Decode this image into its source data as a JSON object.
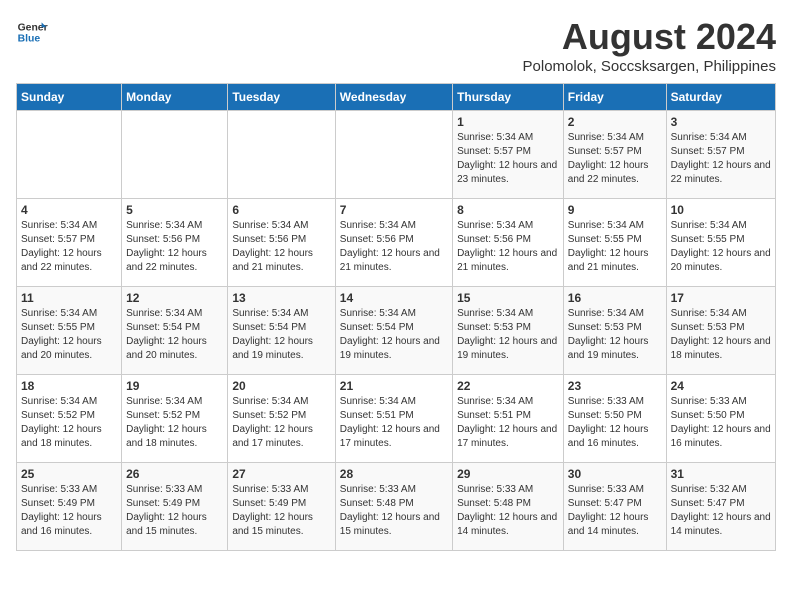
{
  "header": {
    "logo_line1": "General",
    "logo_line2": "Blue",
    "month_year": "August 2024",
    "location": "Polomolok, Soccsksargen, Philippines"
  },
  "weekdays": [
    "Sunday",
    "Monday",
    "Tuesday",
    "Wednesday",
    "Thursday",
    "Friday",
    "Saturday"
  ],
  "weeks": [
    [
      {
        "day": "",
        "sunrise": "",
        "sunset": "",
        "daylight": ""
      },
      {
        "day": "",
        "sunrise": "",
        "sunset": "",
        "daylight": ""
      },
      {
        "day": "",
        "sunrise": "",
        "sunset": "",
        "daylight": ""
      },
      {
        "day": "",
        "sunrise": "",
        "sunset": "",
        "daylight": ""
      },
      {
        "day": "1",
        "sunrise": "Sunrise: 5:34 AM",
        "sunset": "Sunset: 5:57 PM",
        "daylight": "Daylight: 12 hours and 23 minutes."
      },
      {
        "day": "2",
        "sunrise": "Sunrise: 5:34 AM",
        "sunset": "Sunset: 5:57 PM",
        "daylight": "Daylight: 12 hours and 22 minutes."
      },
      {
        "day": "3",
        "sunrise": "Sunrise: 5:34 AM",
        "sunset": "Sunset: 5:57 PM",
        "daylight": "Daylight: 12 hours and 22 minutes."
      }
    ],
    [
      {
        "day": "4",
        "sunrise": "Sunrise: 5:34 AM",
        "sunset": "Sunset: 5:57 PM",
        "daylight": "Daylight: 12 hours and 22 minutes."
      },
      {
        "day": "5",
        "sunrise": "Sunrise: 5:34 AM",
        "sunset": "Sunset: 5:56 PM",
        "daylight": "Daylight: 12 hours and 22 minutes."
      },
      {
        "day": "6",
        "sunrise": "Sunrise: 5:34 AM",
        "sunset": "Sunset: 5:56 PM",
        "daylight": "Daylight: 12 hours and 21 minutes."
      },
      {
        "day": "7",
        "sunrise": "Sunrise: 5:34 AM",
        "sunset": "Sunset: 5:56 PM",
        "daylight": "Daylight: 12 hours and 21 minutes."
      },
      {
        "day": "8",
        "sunrise": "Sunrise: 5:34 AM",
        "sunset": "Sunset: 5:56 PM",
        "daylight": "Daylight: 12 hours and 21 minutes."
      },
      {
        "day": "9",
        "sunrise": "Sunrise: 5:34 AM",
        "sunset": "Sunset: 5:55 PM",
        "daylight": "Daylight: 12 hours and 21 minutes."
      },
      {
        "day": "10",
        "sunrise": "Sunrise: 5:34 AM",
        "sunset": "Sunset: 5:55 PM",
        "daylight": "Daylight: 12 hours and 20 minutes."
      }
    ],
    [
      {
        "day": "11",
        "sunrise": "Sunrise: 5:34 AM",
        "sunset": "Sunset: 5:55 PM",
        "daylight": "Daylight: 12 hours and 20 minutes."
      },
      {
        "day": "12",
        "sunrise": "Sunrise: 5:34 AM",
        "sunset": "Sunset: 5:54 PM",
        "daylight": "Daylight: 12 hours and 20 minutes."
      },
      {
        "day": "13",
        "sunrise": "Sunrise: 5:34 AM",
        "sunset": "Sunset: 5:54 PM",
        "daylight": "Daylight: 12 hours and 19 minutes."
      },
      {
        "day": "14",
        "sunrise": "Sunrise: 5:34 AM",
        "sunset": "Sunset: 5:54 PM",
        "daylight": "Daylight: 12 hours and 19 minutes."
      },
      {
        "day": "15",
        "sunrise": "Sunrise: 5:34 AM",
        "sunset": "Sunset: 5:53 PM",
        "daylight": "Daylight: 12 hours and 19 minutes."
      },
      {
        "day": "16",
        "sunrise": "Sunrise: 5:34 AM",
        "sunset": "Sunset: 5:53 PM",
        "daylight": "Daylight: 12 hours and 19 minutes."
      },
      {
        "day": "17",
        "sunrise": "Sunrise: 5:34 AM",
        "sunset": "Sunset: 5:53 PM",
        "daylight": "Daylight: 12 hours and 18 minutes."
      }
    ],
    [
      {
        "day": "18",
        "sunrise": "Sunrise: 5:34 AM",
        "sunset": "Sunset: 5:52 PM",
        "daylight": "Daylight: 12 hours and 18 minutes."
      },
      {
        "day": "19",
        "sunrise": "Sunrise: 5:34 AM",
        "sunset": "Sunset: 5:52 PM",
        "daylight": "Daylight: 12 hours and 18 minutes."
      },
      {
        "day": "20",
        "sunrise": "Sunrise: 5:34 AM",
        "sunset": "Sunset: 5:52 PM",
        "daylight": "Daylight: 12 hours and 17 minutes."
      },
      {
        "day": "21",
        "sunrise": "Sunrise: 5:34 AM",
        "sunset": "Sunset: 5:51 PM",
        "daylight": "Daylight: 12 hours and 17 minutes."
      },
      {
        "day": "22",
        "sunrise": "Sunrise: 5:34 AM",
        "sunset": "Sunset: 5:51 PM",
        "daylight": "Daylight: 12 hours and 17 minutes."
      },
      {
        "day": "23",
        "sunrise": "Sunrise: 5:33 AM",
        "sunset": "Sunset: 5:50 PM",
        "daylight": "Daylight: 12 hours and 16 minutes."
      },
      {
        "day": "24",
        "sunrise": "Sunrise: 5:33 AM",
        "sunset": "Sunset: 5:50 PM",
        "daylight": "Daylight: 12 hours and 16 minutes."
      }
    ],
    [
      {
        "day": "25",
        "sunrise": "Sunrise: 5:33 AM",
        "sunset": "Sunset: 5:49 PM",
        "daylight": "Daylight: 12 hours and 16 minutes."
      },
      {
        "day": "26",
        "sunrise": "Sunrise: 5:33 AM",
        "sunset": "Sunset: 5:49 PM",
        "daylight": "Daylight: 12 hours and 15 minutes."
      },
      {
        "day": "27",
        "sunrise": "Sunrise: 5:33 AM",
        "sunset": "Sunset: 5:49 PM",
        "daylight": "Daylight: 12 hours and 15 minutes."
      },
      {
        "day": "28",
        "sunrise": "Sunrise: 5:33 AM",
        "sunset": "Sunset: 5:48 PM",
        "daylight": "Daylight: 12 hours and 15 minutes."
      },
      {
        "day": "29",
        "sunrise": "Sunrise: 5:33 AM",
        "sunset": "Sunset: 5:48 PM",
        "daylight": "Daylight: 12 hours and 14 minutes."
      },
      {
        "day": "30",
        "sunrise": "Sunrise: 5:33 AM",
        "sunset": "Sunset: 5:47 PM",
        "daylight": "Daylight: 12 hours and 14 minutes."
      },
      {
        "day": "31",
        "sunrise": "Sunrise: 5:32 AM",
        "sunset": "Sunset: 5:47 PM",
        "daylight": "Daylight: 12 hours and 14 minutes."
      }
    ]
  ]
}
